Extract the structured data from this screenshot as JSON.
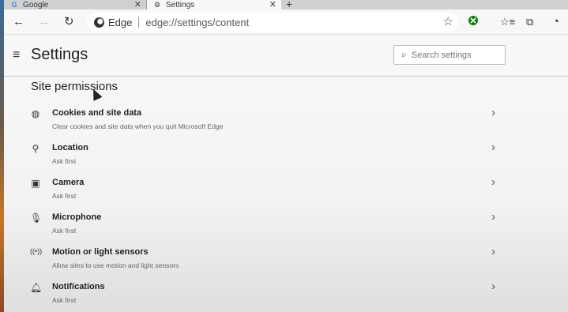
{
  "tabs": [
    {
      "title": "Google",
      "favicon": "G"
    },
    {
      "title": "Settings"
    }
  ],
  "toolbar": {
    "brand": "Edge",
    "url": "edge://settings/content"
  },
  "settings": {
    "title": "Settings",
    "search_placeholder": "Search settings"
  },
  "section": {
    "title": "Site permissions"
  },
  "permissions": [
    {
      "icon": "cookie-icon",
      "title": "Cookies and site data",
      "subtitle": "Clear cookies and site data when you quit Microsoft Edge"
    },
    {
      "icon": "location-icon",
      "title": "Location",
      "subtitle": "Ask first"
    },
    {
      "icon": "camera-icon",
      "title": "Camera",
      "subtitle": "Ask first"
    },
    {
      "icon": "microphone-icon",
      "title": "Microphone",
      "subtitle": "Ask first"
    },
    {
      "icon": "sensors-icon",
      "title": "Motion or light sensors",
      "subtitle": "Allow sites to use motion and light sensors"
    },
    {
      "icon": "bell-icon",
      "title": "Notifications",
      "subtitle": "Ask first"
    }
  ],
  "colors": {
    "tabstrip": "#cfd0d2",
    "background": "#f7f7f7",
    "xbox_green": "#107c10"
  }
}
